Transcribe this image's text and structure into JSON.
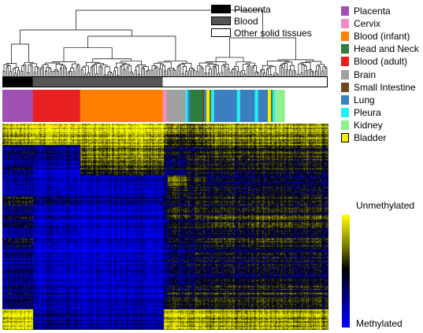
{
  "top_legend": [
    {
      "label": "Placenta",
      "color": "#000000"
    },
    {
      "label": "Blood",
      "color": "#555555"
    },
    {
      "label": "Other solid tissues",
      "color": "#ffffff"
    }
  ],
  "tissue_legend": [
    {
      "label": "Placenta",
      "color": "#a050b4"
    },
    {
      "label": "Cervix",
      "color": "#f08cc8"
    },
    {
      "label": "Blood (infant)",
      "color": "#ff8000"
    },
    {
      "label": "Head and Neck",
      "color": "#2e7d3c"
    },
    {
      "label": "Blood (adult)",
      "color": "#e82020"
    },
    {
      "label": "Brain",
      "color": "#a0a0a0"
    },
    {
      "label": "Small Intestine",
      "color": "#6b4a1e"
    },
    {
      "label": "Lung",
      "color": "#3c7fc0"
    },
    {
      "label": "Pleura",
      "color": "#20f0f0"
    },
    {
      "label": "Kidney",
      "color": "#90f090"
    },
    {
      "label": "Bladder",
      "color": "#f0f000"
    }
  ],
  "color_scale": {
    "top_label": "Unmethylated",
    "bottom_label": "Methylated",
    "high_color": "#ffff00",
    "mid_color": "#000000",
    "low_color": "#0000ff"
  },
  "group_bar": [
    {
      "group": "Placenta",
      "fraction": 0.094
    },
    {
      "group": "Blood",
      "fraction": 0.399
    },
    {
      "group": "Other solid tissues",
      "fraction": 0.507
    }
  ],
  "tissue_bar": [
    {
      "tissue": "Placenta",
      "fraction": 0.094
    },
    {
      "tissue": "Blood (adult)",
      "fraction": 0.145
    },
    {
      "tissue": "Blood (infant)",
      "fraction": 0.254
    },
    {
      "tissue": "Cervix",
      "fraction": 0.012
    },
    {
      "tissue": "Brain",
      "fraction": 0.058
    },
    {
      "tissue": "Pleura",
      "fraction": 0.007
    },
    {
      "tissue": "Lung",
      "fraction": 0.007
    },
    {
      "tissue": "Head and Neck",
      "fraction": 0.038
    },
    {
      "tissue": "Small Intestine",
      "fraction": 0.005
    },
    {
      "tissue": "Lung",
      "fraction": 0.007
    },
    {
      "tissue": "Bladder",
      "fraction": 0.01
    },
    {
      "tissue": "Small Intestine",
      "fraction": 0.004
    },
    {
      "tissue": "Pleura",
      "fraction": 0.01
    },
    {
      "tissue": "Lung",
      "fraction": 0.07
    },
    {
      "tissue": "Pleura",
      "fraction": 0.01
    },
    {
      "tissue": "Lung",
      "fraction": 0.045
    },
    {
      "tissue": "Pleura",
      "fraction": 0.01
    },
    {
      "tissue": "Lung",
      "fraction": 0.03
    },
    {
      "tissue": "Bladder",
      "fraction": 0.01
    },
    {
      "tissue": "Small Intestine",
      "fraction": 0.004
    },
    {
      "tissue": "Pleura",
      "fraction": 0.008
    },
    {
      "tissue": "Kidney",
      "fraction": 0.03
    }
  ],
  "heatmap_sample_blocks": [
    {
      "fraction": 0.094,
      "values": [
        0.85,
        0.8,
        0.3,
        0.25,
        0.35,
        0.2,
        0.15,
        0.45,
        0.3,
        0.35,
        0.25,
        0.4,
        0.3,
        0.2,
        0.3,
        0.25,
        0.3,
        0.25,
        0.95,
        0.9
      ]
    },
    {
      "fraction": 0.145,
      "values": [
        0.9,
        0.85,
        0.25,
        0.2,
        0.15,
        0.1,
        0.1,
        0.25,
        0.1,
        0.1,
        0.15,
        0.1,
        0.1,
        0.1,
        0.1,
        0.1,
        0.15,
        0.1,
        0.2,
        0.2
      ]
    },
    {
      "fraction": 0.254,
      "values": [
        0.9,
        0.85,
        0.75,
        0.7,
        0.6,
        0.15,
        0.1,
        0.2,
        0.1,
        0.1,
        0.1,
        0.1,
        0.1,
        0.1,
        0.15,
        0.1,
        0.1,
        0.1,
        0.15,
        0.15
      ]
    },
    {
      "fraction": 0.012,
      "values": [
        0.7,
        0.6,
        0.4,
        0.3,
        0.3,
        0.2,
        0.2,
        0.3,
        0.3,
        0.2,
        0.3,
        0.2,
        0.2,
        0.2,
        0.2,
        0.2,
        0.3,
        0.3,
        0.8,
        0.8
      ]
    },
    {
      "fraction": 0.058,
      "values": [
        0.7,
        0.55,
        0.45,
        0.35,
        0.4,
        0.7,
        0.5,
        0.4,
        0.55,
        0.45,
        0.45,
        0.4,
        0.35,
        0.35,
        0.35,
        0.35,
        0.5,
        0.45,
        0.9,
        0.85
      ]
    },
    {
      "fraction": 0.062,
      "values": [
        0.65,
        0.6,
        0.45,
        0.5,
        0.55,
        0.5,
        0.45,
        0.45,
        0.5,
        0.45,
        0.45,
        0.4,
        0.45,
        0.4,
        0.4,
        0.4,
        0.5,
        0.45,
        0.85,
        0.8
      ]
    },
    {
      "fraction": 0.375,
      "values": [
        0.75,
        0.7,
        0.55,
        0.5,
        0.5,
        0.35,
        0.4,
        0.45,
        0.5,
        0.55,
        0.45,
        0.5,
        0.45,
        0.4,
        0.4,
        0.45,
        0.5,
        0.45,
        0.8,
        0.75
      ]
    }
  ]
}
